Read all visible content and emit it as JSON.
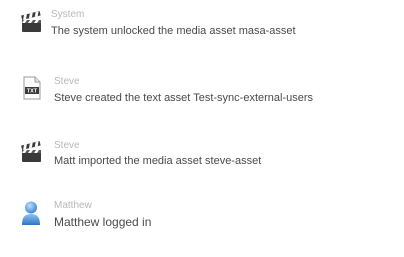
{
  "activity": [
    {
      "icon": "clapperboard-icon",
      "author": "System",
      "message": "The system unlocked the media asset masa-asset"
    },
    {
      "icon": "text-file-icon",
      "icon_badge": "TXT",
      "author": "Steve",
      "message": "Steve created the text asset Test-sync-external-users"
    },
    {
      "icon": "clapperboard-icon",
      "author": "Steve",
      "message": "Matt imported the media asset steve-asset"
    },
    {
      "icon": "user-icon",
      "author": "Matthew",
      "message": "Matthew logged in"
    }
  ],
  "colors": {
    "author_text": "#b8b8b8",
    "message_text": "#4a4a4a",
    "user_icon_blue": "#4a90d9"
  }
}
